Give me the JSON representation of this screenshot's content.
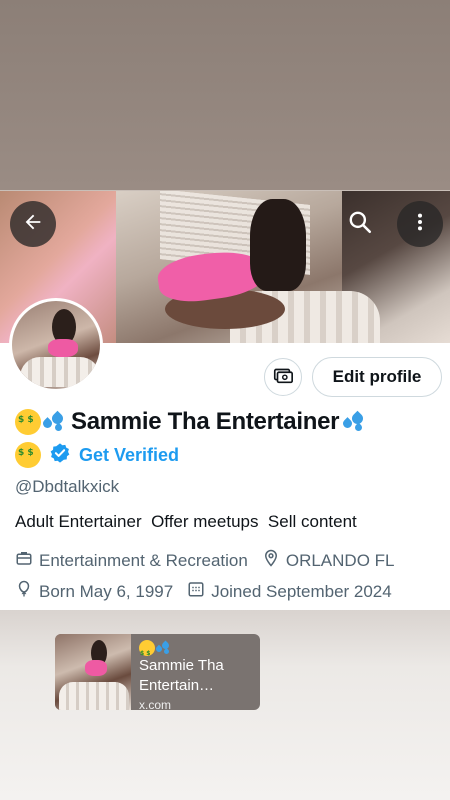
{
  "profile": {
    "display_name": "Sammie Tha Entertainer",
    "get_verified_label": "Get Verified",
    "handle": "@Dbdtalkxick",
    "bio": "Adult Entertainer  Offer meetups  Sell content",
    "category": "Entertainment & Recreation",
    "location": "ORLANDO FL",
    "birthday": "Born May 6, 1997",
    "joined": "Joined September 2024"
  },
  "actions": {
    "edit_profile_label": "Edit profile"
  },
  "link_preview": {
    "title": "Sammie Tha Entertain…",
    "domain": "x.com"
  },
  "icons": {
    "back": "arrow-left-icon",
    "search": "search-icon",
    "more": "more-vertical-icon",
    "money": "money-icon",
    "verified": "verified-badge-icon",
    "category": "briefcase-icon",
    "location": "location-pin-icon",
    "birthday": "balloon-icon",
    "joined": "calendar-icon"
  },
  "colors": {
    "accent": "#1d9bf0",
    "text_primary": "#0f1419",
    "text_secondary": "#536471",
    "border": "#cfd9de"
  }
}
